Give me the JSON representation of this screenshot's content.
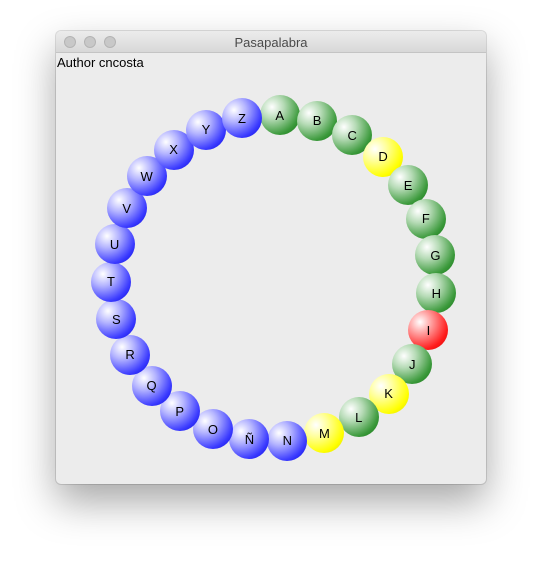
{
  "window": {
    "title": "Pasapalabra"
  },
  "author_label": "Author cncosta",
  "colors": {
    "blue": "#1f1fff",
    "green": "#2e8b2e",
    "yellow": "#ffff00",
    "red": "#ff1a1a"
  },
  "letters": [
    {
      "letter": "A",
      "status": "green"
    },
    {
      "letter": "B",
      "status": "green"
    },
    {
      "letter": "C",
      "status": "green"
    },
    {
      "letter": "D",
      "status": "yellow"
    },
    {
      "letter": "E",
      "status": "green"
    },
    {
      "letter": "F",
      "status": "green"
    },
    {
      "letter": "G",
      "status": "green"
    },
    {
      "letter": "H",
      "status": "green"
    },
    {
      "letter": "I",
      "status": "red"
    },
    {
      "letter": "J",
      "status": "green"
    },
    {
      "letter": "K",
      "status": "yellow"
    },
    {
      "letter": "L",
      "status": "green"
    },
    {
      "letter": "M",
      "status": "yellow"
    },
    {
      "letter": "N",
      "status": "blue"
    },
    {
      "letter": "Ñ",
      "status": "blue"
    },
    {
      "letter": "O",
      "status": "blue"
    },
    {
      "letter": "P",
      "status": "blue"
    },
    {
      "letter": "Q",
      "status": "blue"
    },
    {
      "letter": "R",
      "status": "blue"
    },
    {
      "letter": "S",
      "status": "blue"
    },
    {
      "letter": "T",
      "status": "blue"
    },
    {
      "letter": "U",
      "status": "blue"
    },
    {
      "letter": "V",
      "status": "blue"
    },
    {
      "letter": "W",
      "status": "blue"
    },
    {
      "letter": "X",
      "status": "blue"
    },
    {
      "letter": "Y",
      "status": "blue"
    },
    {
      "letter": "Z",
      "status": "blue"
    }
  ]
}
